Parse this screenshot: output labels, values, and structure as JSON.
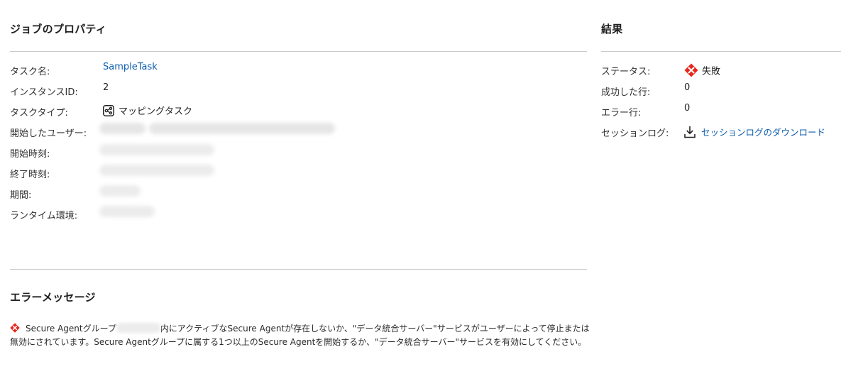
{
  "job_properties": {
    "title": "ジョブのプロパティ",
    "task_name_label": "タスク名:",
    "task_name_value": "SampleTask",
    "instance_id_label": "インスタンスID:",
    "instance_id_value": "2",
    "task_type_label": "タスクタイプ:",
    "task_type_value": "マッピングタスク",
    "task_type_icon": "mapping-task-icon",
    "started_by_label": "開始したユーザー:",
    "start_time_label": "開始時刻:",
    "end_time_label": "終了時刻:",
    "duration_label": "期間:",
    "runtime_env_label": "ランタイム環境:"
  },
  "results": {
    "title": "結果",
    "status_label": "ステータス:",
    "status_value": "失敗",
    "status_icon": "error-icon",
    "success_rows_label": "成功した行:",
    "success_rows_value": "0",
    "error_rows_label": "エラー行:",
    "error_rows_value": "0",
    "session_log_label": "セッションログ:",
    "session_log_link": "セッションログのダウンロード",
    "session_log_icon": "download-icon"
  },
  "error_message": {
    "title": "エラーメッセージ",
    "text_part1": "Secure Agentグループ",
    "text_part2": "内にアクティブなSecure Agentが存在しないか、\"データ統合サーバー\"サービスがユーザーによって停止または無効にされています。Secure Agentグループに属する1つ以上のSecure Agentを開始するか、\"データ統合サーバー\"サービスを有効にしてください。",
    "icon": "error-icon"
  },
  "colors": {
    "link": "#0b5cad",
    "error_red": "#e8261d",
    "rule": "#c9c9c9"
  }
}
